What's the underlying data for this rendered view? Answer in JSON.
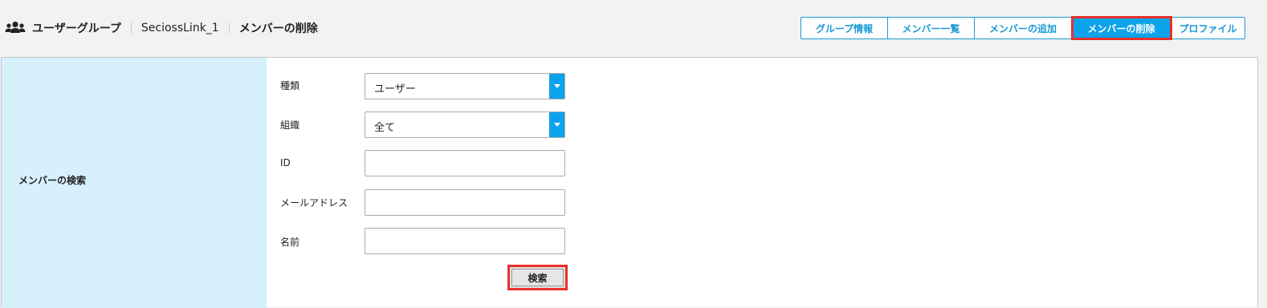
{
  "header": {
    "group_icon": "users-icon",
    "crumb_1": "ユーザーグループ",
    "crumb_2": "SeciossLink_1",
    "crumb_3": "メンバーの削除"
  },
  "tabs": [
    {
      "label": "グループ情報",
      "active": false
    },
    {
      "label": "メンバー一覧",
      "active": false
    },
    {
      "label": "メンバーの追加",
      "active": false
    },
    {
      "label": "メンバーの削除",
      "active": true
    },
    {
      "label": "プロファイル",
      "active": false
    }
  ],
  "search": {
    "section_label": "メンバーの検索",
    "type_label": "種類",
    "type_value": "ユーザー",
    "org_label": "組織",
    "org_value": "全て",
    "id_label": "ID",
    "id_value": "",
    "email_label": "メールアドレス",
    "email_value": "",
    "name_label": "名前",
    "name_value": "",
    "button_label": "検索"
  },
  "colors": {
    "accent": "#0da3ec",
    "highlight": "#e8302a",
    "label_bg": "#d6f0fc"
  }
}
